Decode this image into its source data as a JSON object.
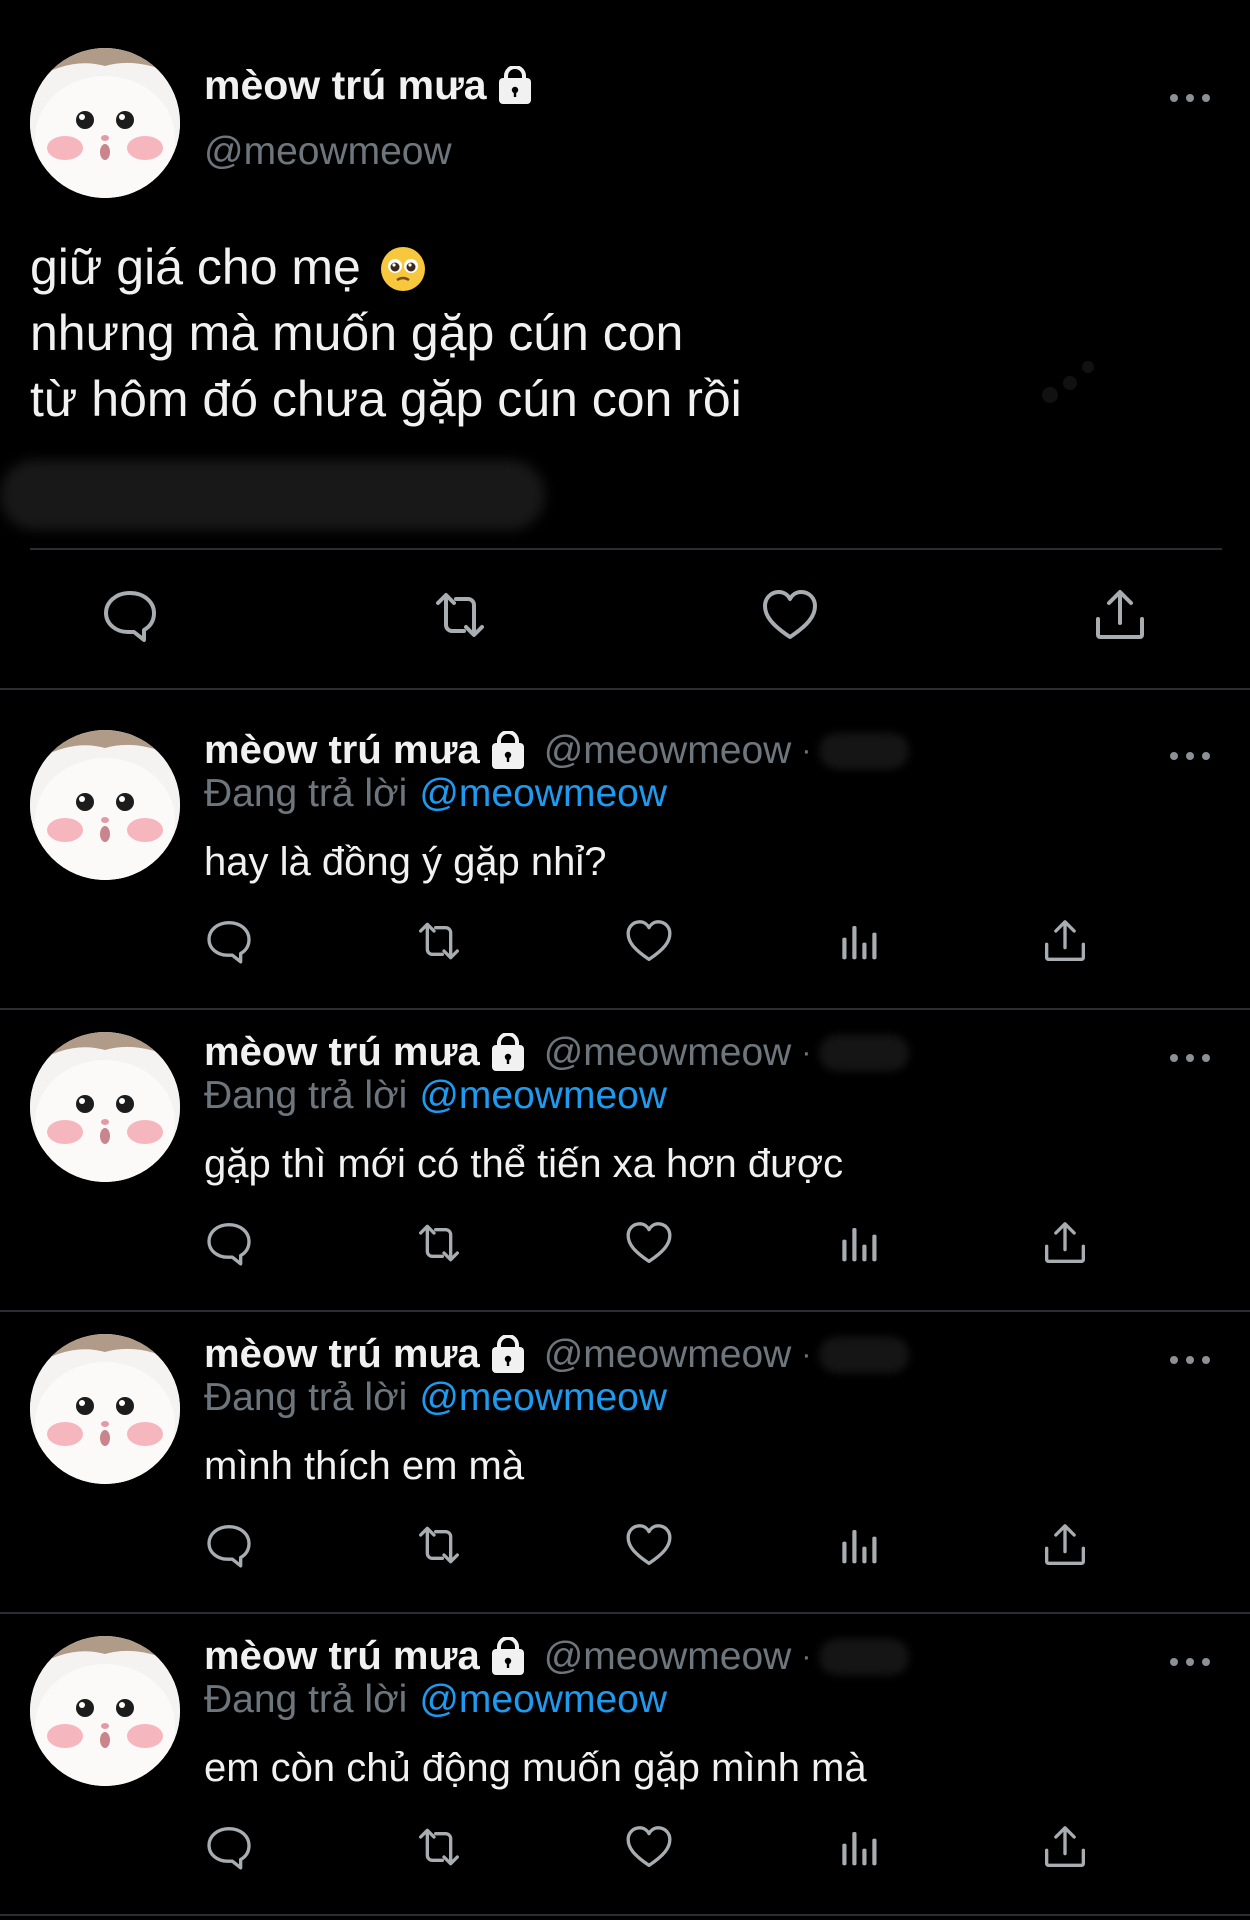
{
  "main_tweet": {
    "author_name": "mèow trú mưa",
    "author_handle": "@meowmeow",
    "text_lines": [
      "giữ giá cho mẹ",
      "nhưng mà muốn gặp cún con",
      "từ hôm đó chưa gặp cún con rồi"
    ],
    "emoji": "pleading-face-emoji"
  },
  "replies": [
    {
      "author_name": "mèow trú mưa",
      "author_handle": "@meowmeow",
      "separator": "·",
      "replying_label": "Đang trả lời",
      "replying_to": "@meowmeow",
      "text": "hay là đồng ý gặp nhỉ?"
    },
    {
      "author_name": "mèow trú mưa",
      "author_handle": "@meowmeow",
      "separator": "·",
      "replying_label": "Đang trả lời",
      "replying_to": "@meowmeow",
      "text": "gặp thì mới có thể tiến xa hơn được"
    },
    {
      "author_name": "mèow trú mưa",
      "author_handle": "@meowmeow",
      "separator": "·",
      "replying_label": "Đang trả lời",
      "replying_to": "@meowmeow",
      "text": "mình thích em mà"
    },
    {
      "author_name": "mèow trú mưa",
      "author_handle": "@meowmeow",
      "separator": "·",
      "replying_label": "Đang trả lời",
      "replying_to": "@meowmeow",
      "text": "em còn chủ động muốn gặp mình mà"
    }
  ],
  "icons": {
    "reply": "reply-icon",
    "retweet": "retweet-icon",
    "like": "heart-icon",
    "analytics": "analytics-icon",
    "share": "share-icon",
    "more": "more-icon",
    "lock": "lock-icon"
  },
  "colors": {
    "background": "#000000",
    "text": "#f1f1f1",
    "secondary": "#6e767d",
    "link": "#1d9bf0",
    "divider": "#2a2e32"
  }
}
